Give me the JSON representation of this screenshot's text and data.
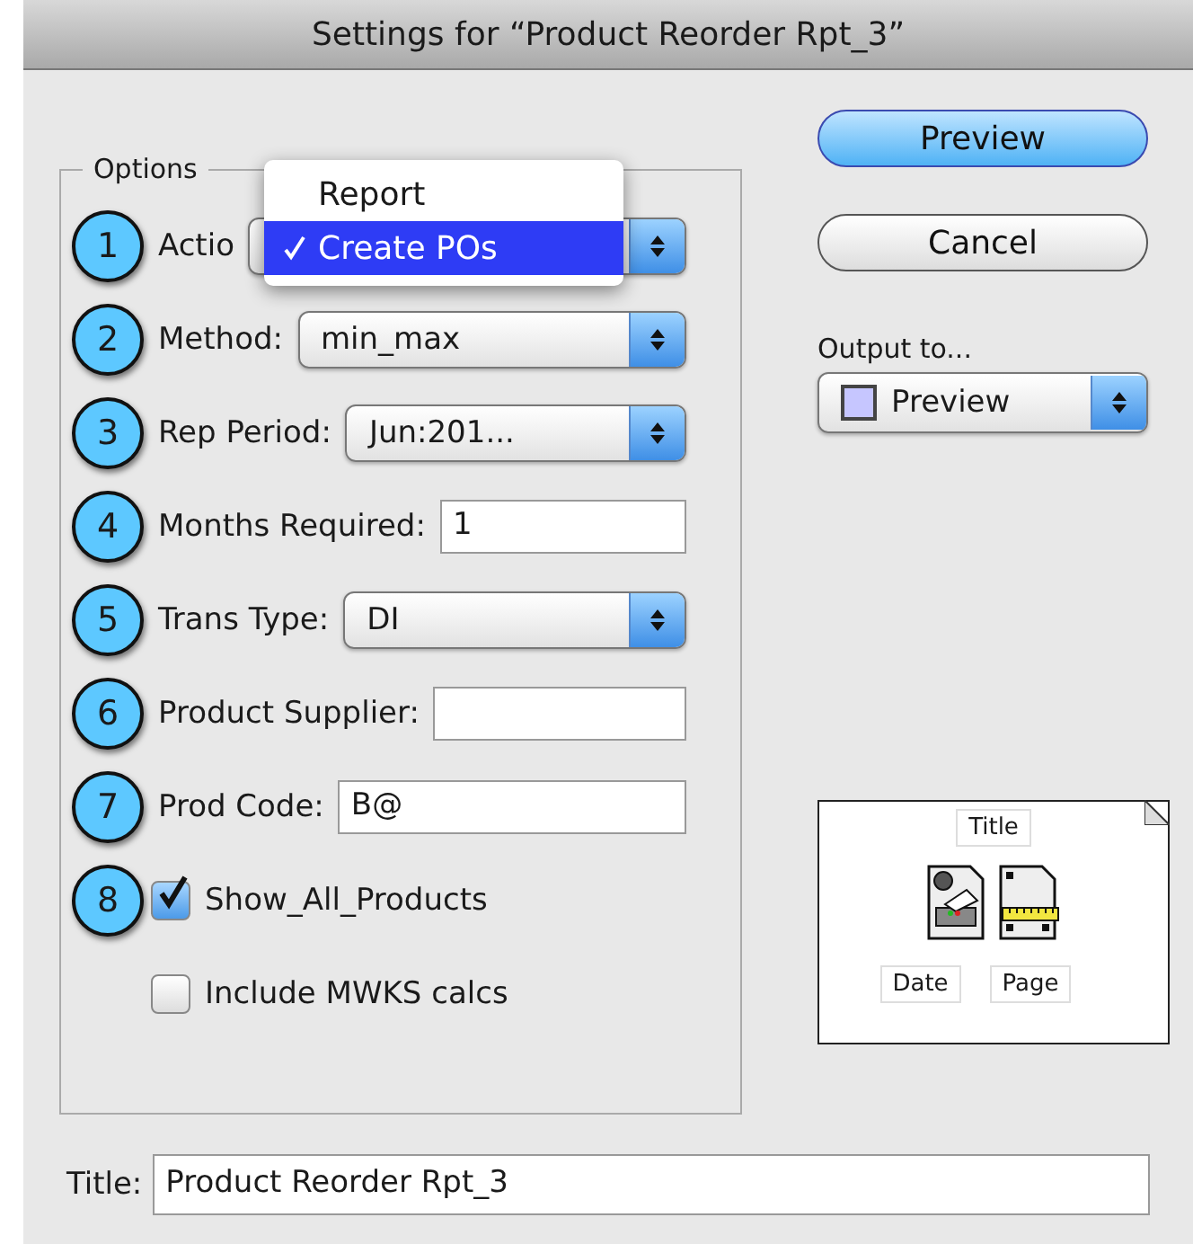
{
  "window": {
    "title": "Settings for “Product Reorder Rpt_3”"
  },
  "options": {
    "legend": "Options",
    "rows": [
      {
        "kind": "popup",
        "number": "1",
        "label": "Actio"
      },
      {
        "kind": "popup",
        "number": "2",
        "label": "Method:",
        "value": "min_max"
      },
      {
        "kind": "popup",
        "number": "3",
        "label": "Rep Period:",
        "value": "Jun:201..."
      },
      {
        "kind": "field",
        "number": "4",
        "label": "Months Required:",
        "value": "1"
      },
      {
        "kind": "popup",
        "number": "5",
        "label": "Trans Type:",
        "value": "DI"
      },
      {
        "kind": "field",
        "number": "6",
        "label": "Product Supplier:"
      },
      {
        "kind": "field",
        "number": "7",
        "label": "Prod Code:",
        "value": "B@"
      },
      {
        "kind": "checkbox",
        "number": "8",
        "label": "Show_All_Products",
        "checked": true
      },
      {
        "kind": "checkbox",
        "label": "Include MWKS calcs",
        "checked": false
      }
    ],
    "open_menu": [
      {
        "label": "Report",
        "selected": false
      },
      {
        "label": "Create POs",
        "selected": true
      }
    ]
  },
  "buttons": [
    {
      "label": "Preview",
      "default": true
    },
    {
      "label": "Cancel",
      "default": false
    }
  ],
  "output": {
    "label": "Output to...",
    "value": "Preview"
  },
  "page_layout": {
    "header": "Title",
    "footers": [
      "Date",
      "Page"
    ]
  },
  "title_field": {
    "label": "Title:",
    "value": "Product Reorder Rpt_3"
  }
}
